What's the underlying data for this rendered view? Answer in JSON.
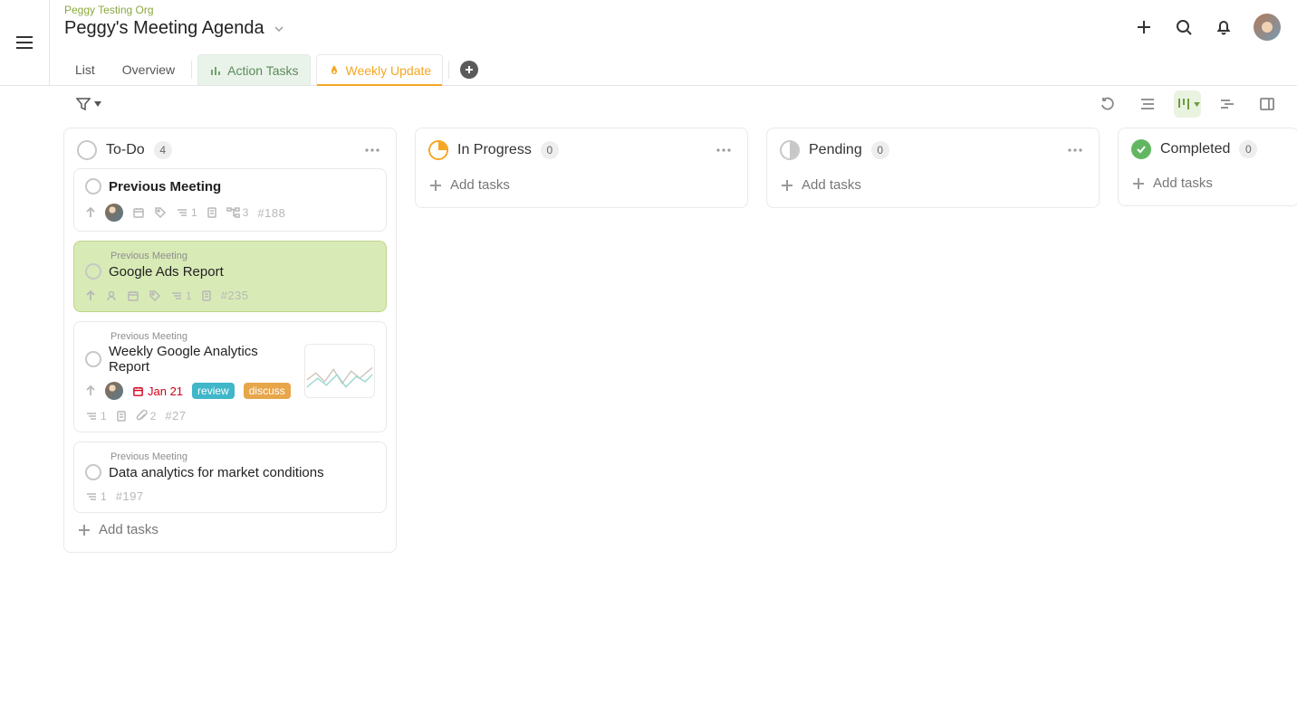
{
  "header": {
    "org": "Peggy Testing Org",
    "title": "Peggy's Meeting Agenda"
  },
  "tabs": {
    "list": "List",
    "overview": "Overview",
    "action": "Action Tasks",
    "weekly": "Weekly Update"
  },
  "toolbar": {
    "add_tasks": "Add tasks"
  },
  "columns": {
    "todo": {
      "title": "To-Do",
      "count": "4"
    },
    "in_progress": {
      "title": "In Progress",
      "count": "0"
    },
    "pending": {
      "title": "Pending",
      "count": "0"
    },
    "completed": {
      "title": "Completed",
      "count": "0"
    }
  },
  "cards": {
    "c1": {
      "title": "Previous Meeting",
      "subtask_count": "1",
      "children_count": "3",
      "hash": "#188"
    },
    "c2": {
      "parent": "Previous Meeting",
      "title": "Google Ads Report",
      "subtask_count": "1",
      "hash": "#235"
    },
    "c3": {
      "parent": "Previous Meeting",
      "title": "Weekly Google Analytics Report",
      "due": "Jan 21",
      "tag_review": "review",
      "tag_discuss": "discuss",
      "subtask_count": "1",
      "attach_count": "2",
      "hash": "#27"
    },
    "c4": {
      "parent": "Previous Meeting",
      "title": "Data analytics for market conditions",
      "subtask_count": "1",
      "hash": "#197"
    }
  }
}
